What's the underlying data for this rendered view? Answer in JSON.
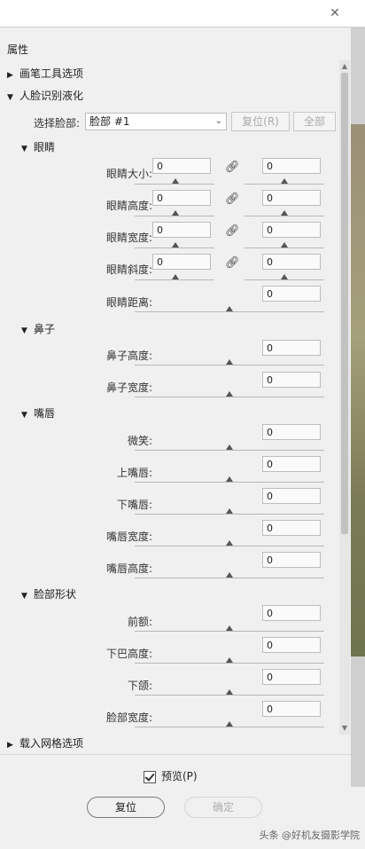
{
  "window": {
    "close_glyph": "✕"
  },
  "panel": {
    "title": "属性"
  },
  "sections": {
    "brush_options": "画笔工具选项",
    "face_liquify": "人脸识别液化",
    "load_mesh": "载入网格选项"
  },
  "face_select": {
    "label": "选择脸部:",
    "value": "脸部 #1",
    "reset_label": "复位(R)",
    "all_label": "全部"
  },
  "eyes": {
    "title": "眼睛",
    "rows": [
      {
        "label": "眼睛大小:",
        "left": "0",
        "right": "0"
      },
      {
        "label": "眼睛高度:",
        "left": "0",
        "right": "0"
      },
      {
        "label": "眼睛宽度:",
        "left": "0",
        "right": "0"
      },
      {
        "label": "眼睛斜度:",
        "left": "0",
        "right": "0"
      }
    ],
    "distance": {
      "label": "眼睛距离:",
      "value": "0"
    }
  },
  "nose": {
    "title": "鼻子",
    "rows": [
      {
        "label": "鼻子高度:",
        "value": "0"
      },
      {
        "label": "鼻子宽度:",
        "value": "0"
      }
    ]
  },
  "mouth": {
    "title": "嘴唇",
    "rows": [
      {
        "label": "微笑:",
        "value": "0"
      },
      {
        "label": "上嘴唇:",
        "value": "0"
      },
      {
        "label": "下嘴唇:",
        "value": "0"
      },
      {
        "label": "嘴唇宽度:",
        "value": "0"
      },
      {
        "label": "嘴唇高度:",
        "value": "0"
      }
    ]
  },
  "face_shape": {
    "title": "脸部形状",
    "rows": [
      {
        "label": "前额:",
        "value": "0"
      },
      {
        "label": "下巴高度:",
        "value": "0"
      },
      {
        "label": "下颌:",
        "value": "0"
      },
      {
        "label": "脸部宽度:",
        "value": "0"
      }
    ]
  },
  "preview": {
    "label": "预览(P)",
    "checked": true
  },
  "buttons": {
    "reset": "复位",
    "ok": "确定"
  },
  "watermark": "头条 @好机友摄影学院",
  "icons": {
    "link": "link-icon",
    "collapsed": "triangle-right-icon",
    "expanded": "triangle-down-icon"
  }
}
